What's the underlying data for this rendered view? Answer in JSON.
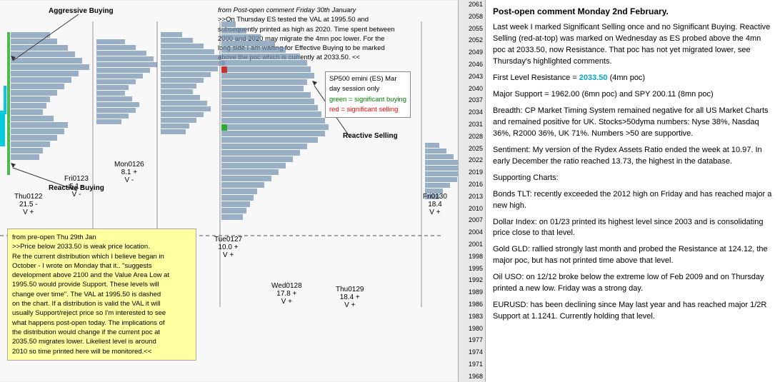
{
  "header": {
    "top_annotation": "from Post-open comment Friday 30th January",
    "top_text_line1": ">>On Thursday ES tested the VAL at 1995.50 and",
    "top_text_line2": "subsequently printed as high as 2020.  Time spent between",
    "top_text_line3": "2000 and 2020 may migrate the 4mn poc lower.  For the",
    "top_text_line4": "long side I am waiting for Effective Buying to be marked",
    "top_text_line5": "above the poc which is currently at 2033.50. <<"
  },
  "annotations": {
    "aggressive_buying": "Aggressive Buying",
    "reactive_buying": "Reactive Buying",
    "reactive_selling": "Reactive Selling",
    "fri0123": "Fri0123\n5.1 -\nV -",
    "mon0126": "Mon0126\n8.1 +\nV -",
    "thu0122": "Thu0122\n21.5 -\nV +",
    "tue0127": "Tue0127\n10.0 +\nV +",
    "wed0128": "Wed0128\n17.8 +\nV +",
    "thu0129": "Thu0129\n18.4 +\nV +",
    "fri0130": "Fri0130\n18.4\nV +"
  },
  "legend": {
    "title": "SP500 emini (ES)  Mar",
    "line1": "day session only",
    "line2_green": "green = significant buying",
    "line3_red": "red = significant selling"
  },
  "yellow_box": {
    "line1": "from pre-open Thu 29th Jan",
    "line2": ">>Price below 2033.50 is weak price location.",
    "line3": "Re the current distribution which I believe began in",
    "line4": "October - I wrote on Monday that it..  \"suggests",
    "line5": "development above 2100 and the Value Area Low at",
    "line6": "1995.50 would provide Support. These levels will",
    "line7": "change over time\".  The VAL at 1995.50 is dashed",
    "line8": "on the chart. If a distribution is valid the VAL it will",
    "line9": "usually Support/reject price so I'm interested to see",
    "line10": "what happens post-open today.  The implications of",
    "line11": "the distribution would change if the current poc at",
    "line12": "2035.50 migrates lower.  Likeliest level is around",
    "line13": "2010 so time printed here will be monitored.<<"
  },
  "right_panel": {
    "title": "Post-open comment Monday 2nd February.",
    "p1": "Last week I marked Significant Selling once and no Significant Buying.  Reactive Selling (red-at-top) was marked on Wednesday as ES probed above the 4mn poc at 2033.50, now Resistance.  That poc has not yet migrated lower, see Thursday's highlighted comments.",
    "p2_label": "First Level Resistance  =",
    "p2_value": "2033.50",
    "p2_suffix": "(4mn poc)",
    "p3": "Major Support = 1962.00  (6mn poc) and  SPY 200.11 (8mn poc)",
    "p4": "Breadth: CP Market Timing System remained negative for all US Market Charts and remained positive for UK. Stocks>50dyma numbers: Nyse 38%, Nasdaq 36%, R2000 36%, UK 71%.  Numbers >50 are supportive.",
    "p5": "Sentiment: My version of the Rydex Assets Ratio ended the week at 10.97. In early December the ratio reached 13.73, the highest in the database.",
    "p6_title": "Supporting Charts:",
    "p6_bonds": "Bonds TLT: recently exceeded the 2012 high on Friday and has reached major a new high.",
    "p6_dollar": "Dollar Index: on 01/23 printed its highest level since 2003 and is consolidating price close to that level.",
    "p6_gold": "Gold GLD: rallied strongly last month and probed the Resistance at 124.12, the major poc, but has not printed time above that level.",
    "p6_oil": "Oil USO: on 12/12 broke below the extreme low of Feb 2009 and on Thursday printed a new low.  Friday was a strong day.",
    "p6_eurusd": "EURUSD: has been declining since May last year and has reached major 1/2R Support at 1.1241.  Currently holding that level."
  },
  "price_levels": [
    "2061",
    "2058",
    "2055",
    "2052",
    "2049",
    "2046",
    "2043",
    "2040",
    "2037",
    "2034",
    "2031",
    "2028",
    "2025",
    "2022",
    "2019",
    "2016",
    "2013",
    "2010",
    "2007",
    "2004",
    "2001",
    "1998",
    "1995",
    "1992",
    "1989",
    "1986",
    "1983",
    "1980",
    "1977",
    "1974",
    "1971",
    "1968"
  ]
}
